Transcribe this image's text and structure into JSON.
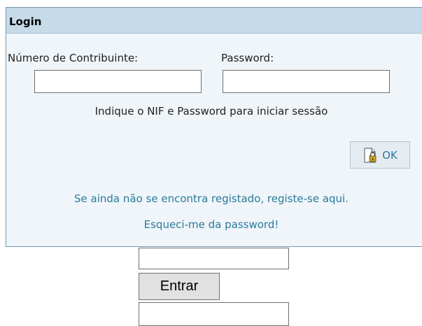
{
  "login": {
    "title": "Login",
    "nif_label": "Número de Contribuinte:",
    "password_label": "Password:",
    "nif_value": "",
    "password_value": "",
    "hint": "Indique o NIF e Password para iniciar sessão",
    "ok_label": "OK",
    "ok_icon": "document-lock-icon",
    "register_link": "Se ainda não se encontra registado, registe-se aqui.",
    "forgot_link": "Esqueci-me da password!"
  },
  "form": {
    "entrar_label": "Entrar",
    "input1_value": "",
    "input2_value": ""
  },
  "colors": {
    "header_bg": "#c6dbe9",
    "panel_bg": "#eff5f9",
    "link": "#2a7a9a",
    "border": "#7796ac"
  }
}
